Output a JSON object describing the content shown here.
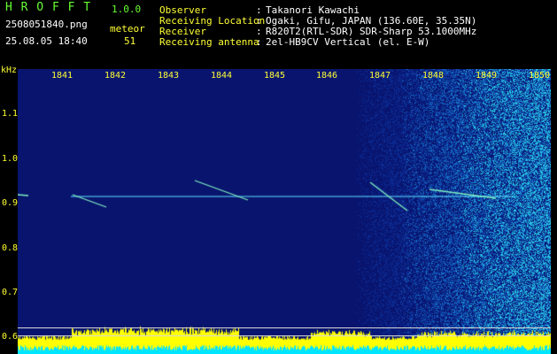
{
  "header": {
    "app_title": "H R O F F T",
    "version": "1.0.0",
    "filename": "2508051840.png",
    "datetime": "25.08.05 18:40",
    "meteor_label": "meteor",
    "meteor_count": "51",
    "info": [
      {
        "label": "Observer",
        "value": "Takanori Kawachi"
      },
      {
        "label": "Receiving Location",
        "value": "Ogaki, Gifu, JAPAN (136.60E, 35.35N)"
      },
      {
        "label": "Receiver",
        "value": "R820T2(RTL-SDR) SDR-Sharp 53.1000MHz"
      },
      {
        "label": "Receiving antenna",
        "value": "2el-HB9CV Vertical (el. E-W)"
      }
    ]
  },
  "axes": {
    "y_unit": "kHz",
    "y_ticks": [
      "1.1",
      "1.0",
      "0.9",
      "0.8",
      "0.7",
      "0.6"
    ],
    "x_ticks": [
      "1841",
      "1842",
      "1843",
      "1844",
      "1845",
      "1846",
      "1847",
      "1848",
      "1849",
      "1850"
    ]
  },
  "colors": {
    "background": "#000000",
    "spectrogram_base": "#0a1a78",
    "header_text": "#ffffff",
    "axis_text": "#ffff33",
    "title_text": "#66ff33",
    "signal": "#ffff00",
    "noise_floor": "#00ffff"
  }
}
